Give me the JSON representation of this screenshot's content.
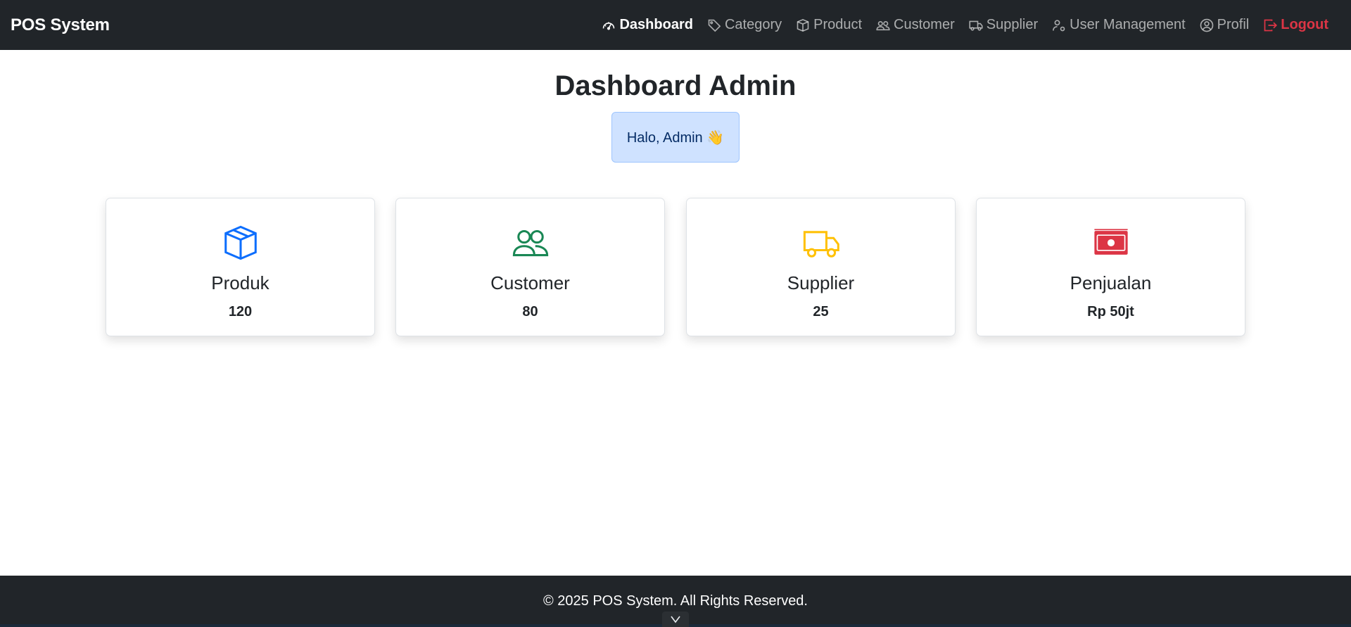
{
  "navbar": {
    "brand": "POS System",
    "items": [
      {
        "label": "Dashboard",
        "icon": "speedometer-icon"
      },
      {
        "label": "Category",
        "icon": "tag-icon"
      },
      {
        "label": "Product",
        "icon": "box-icon"
      },
      {
        "label": "Customer",
        "icon": "people-icon"
      },
      {
        "label": "Supplier",
        "icon": "truck-icon"
      },
      {
        "label": "User Management",
        "icon": "person-gear-icon"
      },
      {
        "label": "Profil",
        "icon": "person-circle-icon"
      },
      {
        "label": "Logout",
        "icon": "logout-icon"
      }
    ],
    "active": "Dashboard"
  },
  "main": {
    "title": "Dashboard Admin",
    "greeting": "Halo, Admin 👋",
    "cards": [
      {
        "title": "Produk",
        "value": "120",
        "icon": "box-icon",
        "color": "#0d6efd"
      },
      {
        "title": "Customer",
        "value": "80",
        "icon": "people-icon",
        "color": "#198754"
      },
      {
        "title": "Supplier",
        "value": "25",
        "icon": "truck-icon",
        "color": "#ffc107"
      },
      {
        "title": "Penjualan",
        "value": "Rp 50jt",
        "icon": "cash-icon",
        "color": "#dc3545"
      }
    ]
  },
  "footer": {
    "text": "© 2025 POS System. All Rights Reserved."
  },
  "colors": {
    "navbar_bg": "#212529",
    "logout": "#dc3545",
    "alert_bg": "#cfe2ff"
  }
}
